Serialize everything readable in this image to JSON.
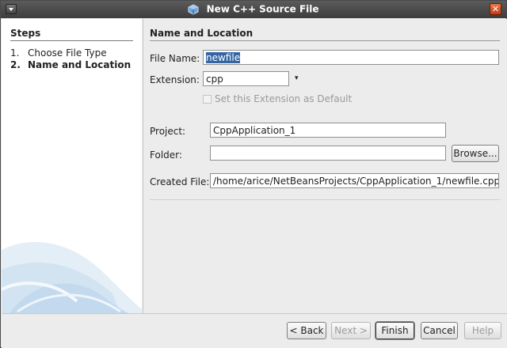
{
  "window": {
    "title": "New C++ Source File",
    "menu_icon": "window-menu-icon",
    "close_icon": "close-icon",
    "title_icon": "netbeans-cube-icon"
  },
  "steps": {
    "title": "Steps",
    "items": [
      {
        "num": "1.",
        "label": "Choose File Type"
      },
      {
        "num": "2.",
        "label": "Name and Location"
      }
    ]
  },
  "form": {
    "section_title": "Name and Location",
    "file_name_label": "File Name:",
    "file_name_value": "newfile",
    "extension_label": "Extension:",
    "extension_value": "cpp",
    "extension_arrow": "▾",
    "default_ext_label": "Set this Extension as Default",
    "project_label": "Project:",
    "project_value": "CppApplication_1",
    "folder_label": "Folder:",
    "folder_value": "",
    "browse_label": "Browse...",
    "created_file_label": "Created File:",
    "created_file_value": "/home/arice/NetBeansProjects/CppApplication_1/newfile.cpp"
  },
  "buttons": {
    "back": "< Back",
    "next": "Next >",
    "finish": "Finish",
    "cancel": "Cancel",
    "help": "Help"
  },
  "colors": {
    "titlebar": "#3d3d3d",
    "selection": "#3465a4",
    "close": "#c23f14"
  }
}
